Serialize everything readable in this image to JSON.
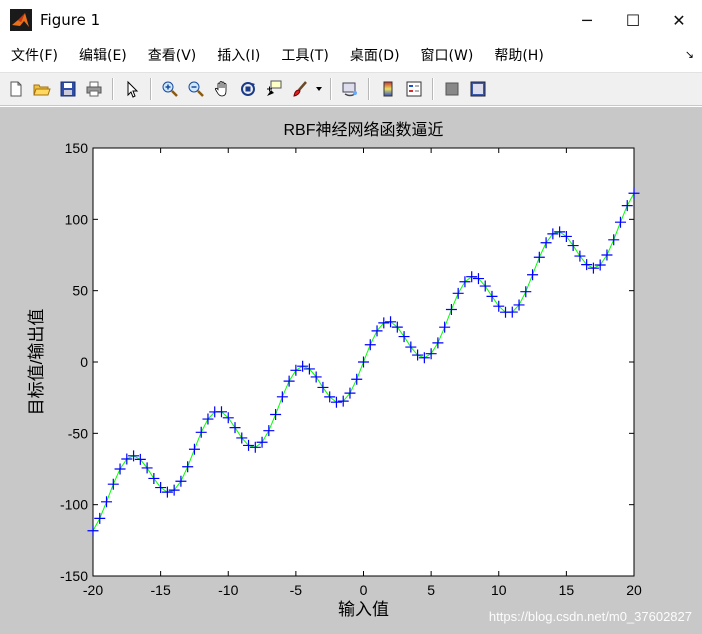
{
  "window": {
    "title": "Figure 1",
    "controls": {
      "minimize": "─",
      "maximize": "☐",
      "close": "✕"
    }
  },
  "menubar": {
    "items": [
      "文件(F)",
      "编辑(E)",
      "查看(V)",
      "插入(I)",
      "工具(T)",
      "桌面(D)",
      "窗口(W)",
      "帮助(H)"
    ],
    "overflow_icon": "↘"
  },
  "toolbar": {
    "icons": [
      "new-figure-icon",
      "open-icon",
      "save-icon",
      "print-icon",
      "pointer-icon",
      "zoom-in-icon",
      "zoom-out-icon",
      "pan-icon",
      "rotate-3d-icon",
      "data-cursor-icon",
      "brush-icon",
      "link-plot-icon",
      "colorbar-icon",
      "legend-icon",
      "hide-plot-tools-icon",
      "show-plot-tools-icon"
    ]
  },
  "colors": {
    "figure_bg": "#c8c8c8",
    "axes_bg": "#ffffff",
    "fit_line": "#00ff00",
    "target_marker": "#0000ff"
  },
  "chart_data": {
    "type": "line",
    "title": "RBF神经网络函数逼近",
    "xlabel": "输入值",
    "ylabel": "目标值/输出值",
    "xlim": [
      -20,
      20
    ],
    "ylim": [
      -150,
      150
    ],
    "xticks": [
      -20,
      -15,
      -10,
      -5,
      0,
      5,
      10,
      15,
      20
    ],
    "yticks": [
      -150,
      -100,
      -50,
      0,
      50,
      100,
      150
    ],
    "grid": false,
    "legend": "none",
    "function": "y = 5x + 20 sin(x)",
    "x_start": -20,
    "x_step": 0.5,
    "x_count": 81,
    "series": [
      {
        "style": "solid",
        "color": "#00ff00"
      },
      {
        "style": "markers-plus",
        "color": "#0000ff"
      }
    ]
  },
  "watermark": "https://blog.csdn.net/m0_37602827"
}
